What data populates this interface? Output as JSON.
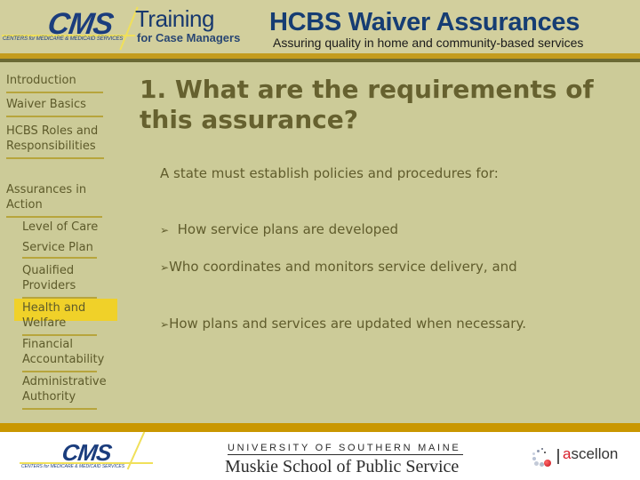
{
  "header": {
    "cms_logo": {
      "text": "CMS",
      "subtitle": "CENTERS for MEDICARE & MEDICAID SERVICES"
    },
    "training": {
      "title": "Training",
      "subtitle": "for Case Managers"
    },
    "course": {
      "title": "HCBS Waiver Assurances",
      "subtitle": "Assuring quality in home and community-based services"
    }
  },
  "sidebar": {
    "items": [
      {
        "label": "Introduction",
        "level": 1
      },
      {
        "label": "Waiver Basics",
        "level": 1
      },
      {
        "label": "HCBS Roles and Responsibilities",
        "level": 1
      },
      {
        "label": "Assurances in Action",
        "level": 1
      },
      {
        "label": "Level of Care",
        "level": 2
      },
      {
        "label": "Service Plan",
        "level": 2,
        "active": true
      },
      {
        "label": "Qualified Providers",
        "level": 2
      },
      {
        "label": "Health and Welfare",
        "level": 2
      },
      {
        "label": "Financial Accountability",
        "level": 2
      },
      {
        "label": "Administrative Authority",
        "level": 2
      }
    ]
  },
  "main": {
    "title": "1. What are the requirements of this assurance?",
    "intro": "A state must establish policies and procedures for:",
    "bullet_glyph": "➢",
    "bullets": [
      "How service plans are developed",
      "Who coordinates and monitors service delivery, and",
      "How plans and services are updated when necessary."
    ]
  },
  "footer": {
    "cms_logo": {
      "text": "CMS",
      "subtitle": "CENTERS for MEDICARE & MEDICAID SERVICES"
    },
    "university": "UNIVERSITY OF SOUTHERN MAINE",
    "school": "Muskie School of Public Service",
    "ascellon": {
      "a": "a",
      "rest": "scellon"
    }
  },
  "colors": {
    "background": "#cccb98",
    "header_gold": "#c49c1e",
    "header_olive": "#6a6934",
    "footer_gold": "#c99700",
    "active_nav": "#f0d129",
    "text_olive": "#605c2c",
    "brand_blue": "#163d73"
  }
}
